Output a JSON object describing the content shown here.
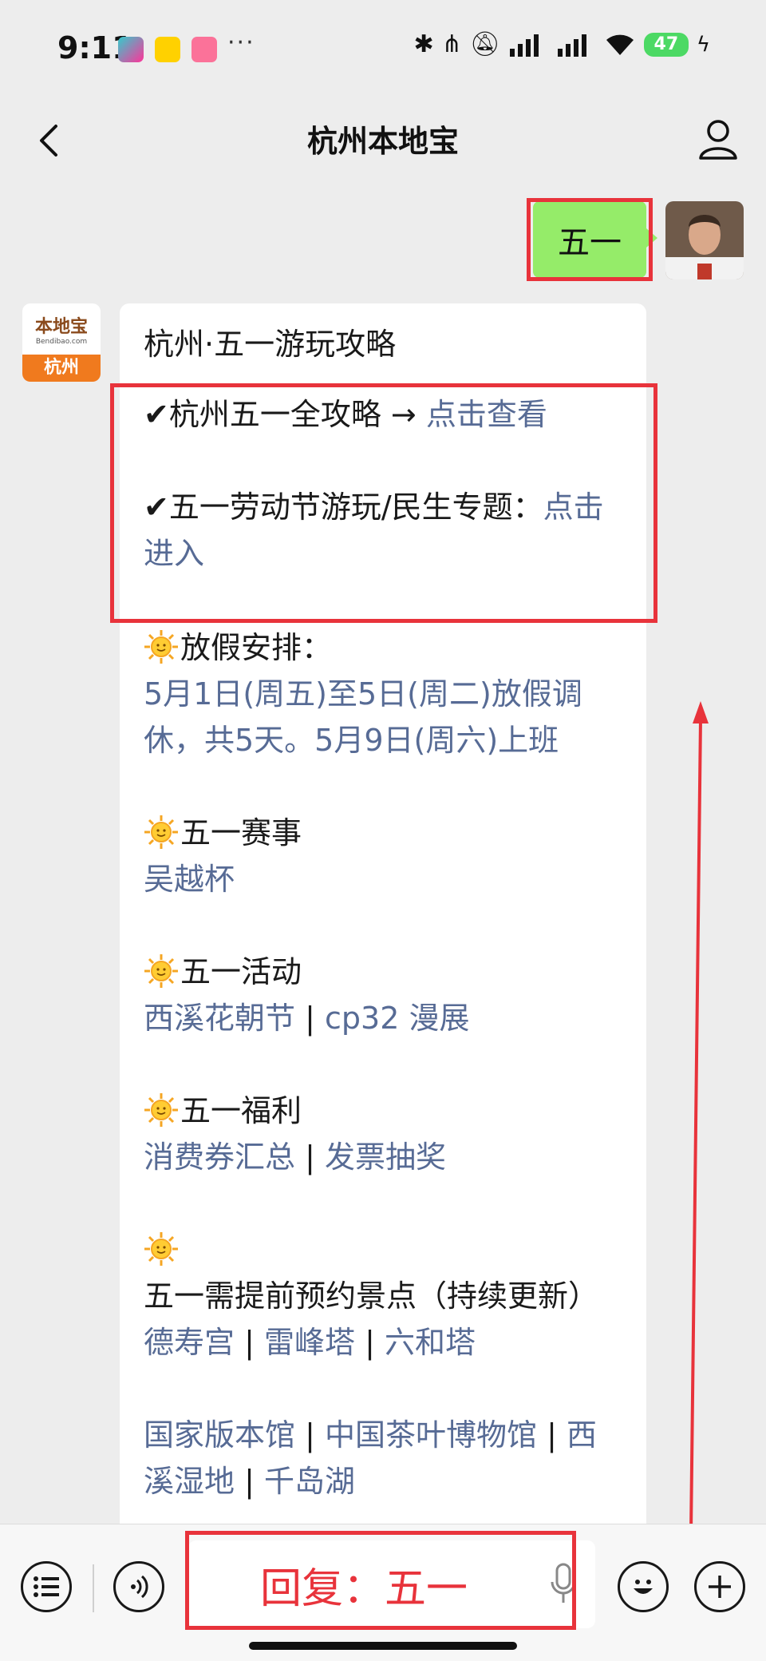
{
  "status_bar": {
    "time": "9:11",
    "app_icons": [
      "video-app-icon",
      "meituan-icon",
      "bilibili-icon"
    ],
    "more": "···",
    "battery": "47"
  },
  "nav": {
    "title": "杭州本地宝"
  },
  "user_message": {
    "text": "五一"
  },
  "bot": {
    "avatar_top": "本地宝",
    "avatar_sub": "Bendibao.com",
    "avatar_city": "杭州",
    "card_title": "杭州·五一游玩攻略",
    "item1_text": "✔杭州五一全攻略 →",
    "item1_link": "点击查看",
    "item2_text": "✔五一劳动节游玩/民生专题：",
    "item2_link": "点击进入",
    "sections": [
      {
        "heading": "放假安排：",
        "body": "5月1日(周五)至5日(周二)放假调休，共5天。5月9日(周六)上班"
      },
      {
        "heading": "五一赛事",
        "body": "吴越杯"
      },
      {
        "heading": "五一活动",
        "links": [
          "西溪花朝节",
          "cp32 漫展"
        ]
      },
      {
        "heading": "五一福利",
        "links": [
          "消费券汇总",
          "发票抽奖"
        ]
      },
      {
        "heading": "五一需提前预约景点（持续更新）",
        "links": [
          "德寿宫",
          "雷峰塔",
          "六和塔"
        ]
      }
    ],
    "more_links": [
      "国家版本馆",
      "中国茶叶博物馆",
      "西溪湿地",
      "千岛湖"
    ]
  },
  "input": {
    "text": "回复：五一"
  },
  "colors": {
    "accent_link": "#576b95",
    "user_bubble": "#95ec69",
    "annotation_red": "#e8333b",
    "background": "#ededed"
  }
}
